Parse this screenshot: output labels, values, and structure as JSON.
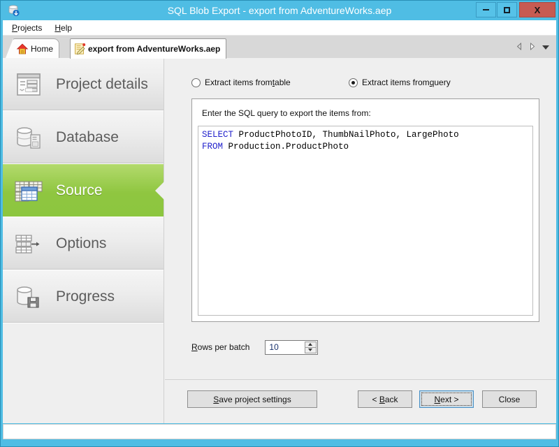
{
  "window": {
    "title": "SQL Blob Export - export from AdventureWorks.aep",
    "app_icon": "database-export-icon",
    "accent_color": "#4fbde4",
    "controls": {
      "minimize": "minimize-icon",
      "maximize": "maximize-icon",
      "close": "X"
    }
  },
  "menubar": {
    "items": [
      {
        "label": "Projects",
        "mnemonic": "P",
        "rest": "rojects"
      },
      {
        "label": "Help",
        "mnemonic": "H",
        "rest": "elp"
      }
    ]
  },
  "tabs": {
    "items": [
      {
        "label": "Home",
        "icon": "home-icon",
        "active": false
      },
      {
        "label": "export from AdventureWorks.aep",
        "icon": "document-edit-icon",
        "active": true
      }
    ],
    "nav": {
      "prev": "prev-tab-arrow-icon",
      "next": "next-tab-arrow-icon",
      "list": "tab-list-dropdown-icon"
    }
  },
  "sidebar": {
    "items": [
      {
        "label": "Project details",
        "icon": "form-details-icon",
        "active": false
      },
      {
        "label": "Database",
        "icon": "database-server-icon",
        "active": false
      },
      {
        "label": "Source",
        "icon": "tables-source-icon",
        "active": true
      },
      {
        "label": "Options",
        "icon": "table-transform-icon",
        "active": false
      },
      {
        "label": "Progress",
        "icon": "database-save-icon",
        "active": false
      }
    ],
    "active_color": "#8cc63f"
  },
  "main": {
    "extract_mode": {
      "options": [
        {
          "label": "Extract items from table",
          "prefix": "Extract items from ",
          "mnemonic": "t",
          "suffix": "able",
          "checked": false
        },
        {
          "label": "Extract items from query",
          "prefix": "Extract items from ",
          "mnemonic": "q",
          "suffix": "uery",
          "checked": true
        }
      ]
    },
    "query_group": {
      "label": "Enter the SQL query to export the items from:",
      "editor": {
        "lines": [
          {
            "keyword": "SELECT",
            "text": " ProductPhotoID, ThumbNailPhoto, LargePhoto"
          },
          {
            "keyword": "FROM",
            "text": " Production.ProductPhoto"
          }
        ],
        "keyword_color": "#2222cc",
        "text_color": "#000000"
      }
    },
    "rows_per_batch": {
      "label": "Rows per batch",
      "label_mnemonic": "R",
      "label_rest": "ows per batch",
      "value": "10",
      "spinner_up": "chevron-up-icon",
      "spinner_down": "chevron-down-icon"
    }
  },
  "buttons": {
    "save": {
      "label": "Save project settings",
      "mnemonic": "S",
      "rest": "ave project settings"
    },
    "back": {
      "label": "< Back",
      "pre": "< ",
      "mnemonic": "B",
      "rest": "ack"
    },
    "next": {
      "label": "Next >",
      "mnemonic": "N",
      "rest": "ext >",
      "focused": true
    },
    "close": {
      "label": "Close"
    }
  },
  "statusbar": {
    "text": ""
  }
}
